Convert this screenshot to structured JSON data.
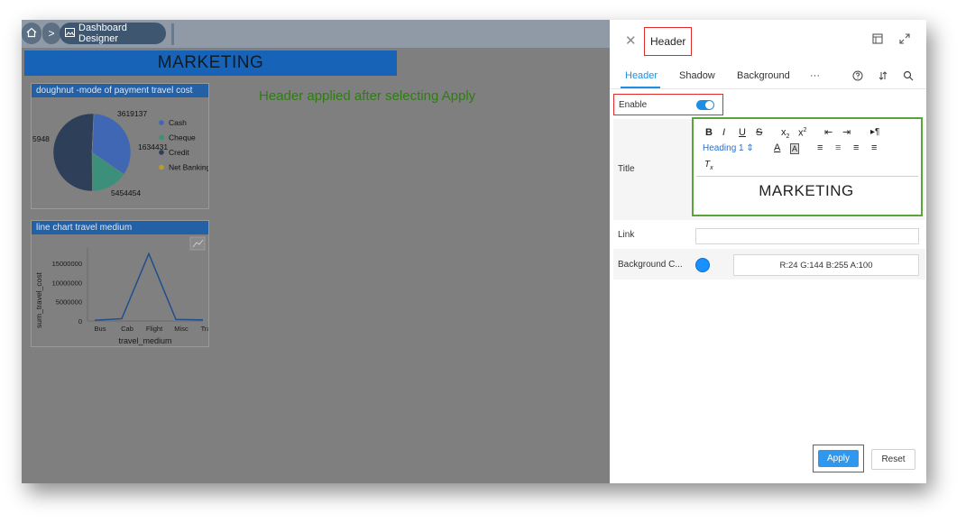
{
  "breadcrumb": {
    "designer_label": "Dashboard Designer"
  },
  "canvas": {
    "banner_text": "MARKETING",
    "note_text": "Header applied after selecting Apply",
    "banner_color": "#1663b8"
  },
  "widgets": {
    "doughnut": {
      "title": "doughnut -mode of payment travel cost",
      "labels": [
        "3619137",
        "1634431",
        "5454454",
        "5948"
      ],
      "legend": [
        "Cash",
        "Cheque",
        "Credit",
        "Net Banking"
      ]
    },
    "line": {
      "title": "line chart travel medium",
      "ylabel": "sum_travel_cost",
      "xlabel": "travel_medium",
      "yticks": [
        "15000000",
        "10000000",
        "5000000",
        "0"
      ],
      "xticks": [
        "Bus",
        "Cab",
        "Flight",
        "Misc",
        "Train"
      ]
    }
  },
  "chart_data": [
    {
      "type": "pie",
      "title": "doughnut -mode of payment travel cost",
      "categories": [
        "Cash",
        "Cheque",
        "Credit",
        "Net Banking"
      ],
      "values": [
        3619137,
        1634431,
        5454454,
        5948
      ],
      "colors": [
        "#3f67b4",
        "#3c8f7a",
        "#2d3f59",
        "#b99a2a"
      ],
      "legend": "right"
    },
    {
      "type": "line",
      "title": "line chart travel medium",
      "xlabel": "travel_medium",
      "ylabel": "sum_travel_cost",
      "categories": [
        "Bus",
        "Cab",
        "Flight",
        "Misc",
        "Train"
      ],
      "values": [
        200000,
        600000,
        17500000,
        400000,
        300000
      ],
      "ylim": [
        0,
        19000000
      ],
      "color": "#1e4f8c"
    }
  ],
  "panel": {
    "title": "Header",
    "tabs": [
      "Header",
      "Shadow",
      "Background",
      "···"
    ],
    "enable_label": "Enable",
    "title_label": "Title",
    "heading_option": "Heading 1",
    "editor_text": "MARKETING",
    "link_label": "Link",
    "link_value": "",
    "bg_label": "Background C...",
    "bg_value": "R:24 G:144 B:255 A:100",
    "bg_swatch": "#1890ff",
    "apply_label": "Apply",
    "reset_label": "Reset"
  }
}
